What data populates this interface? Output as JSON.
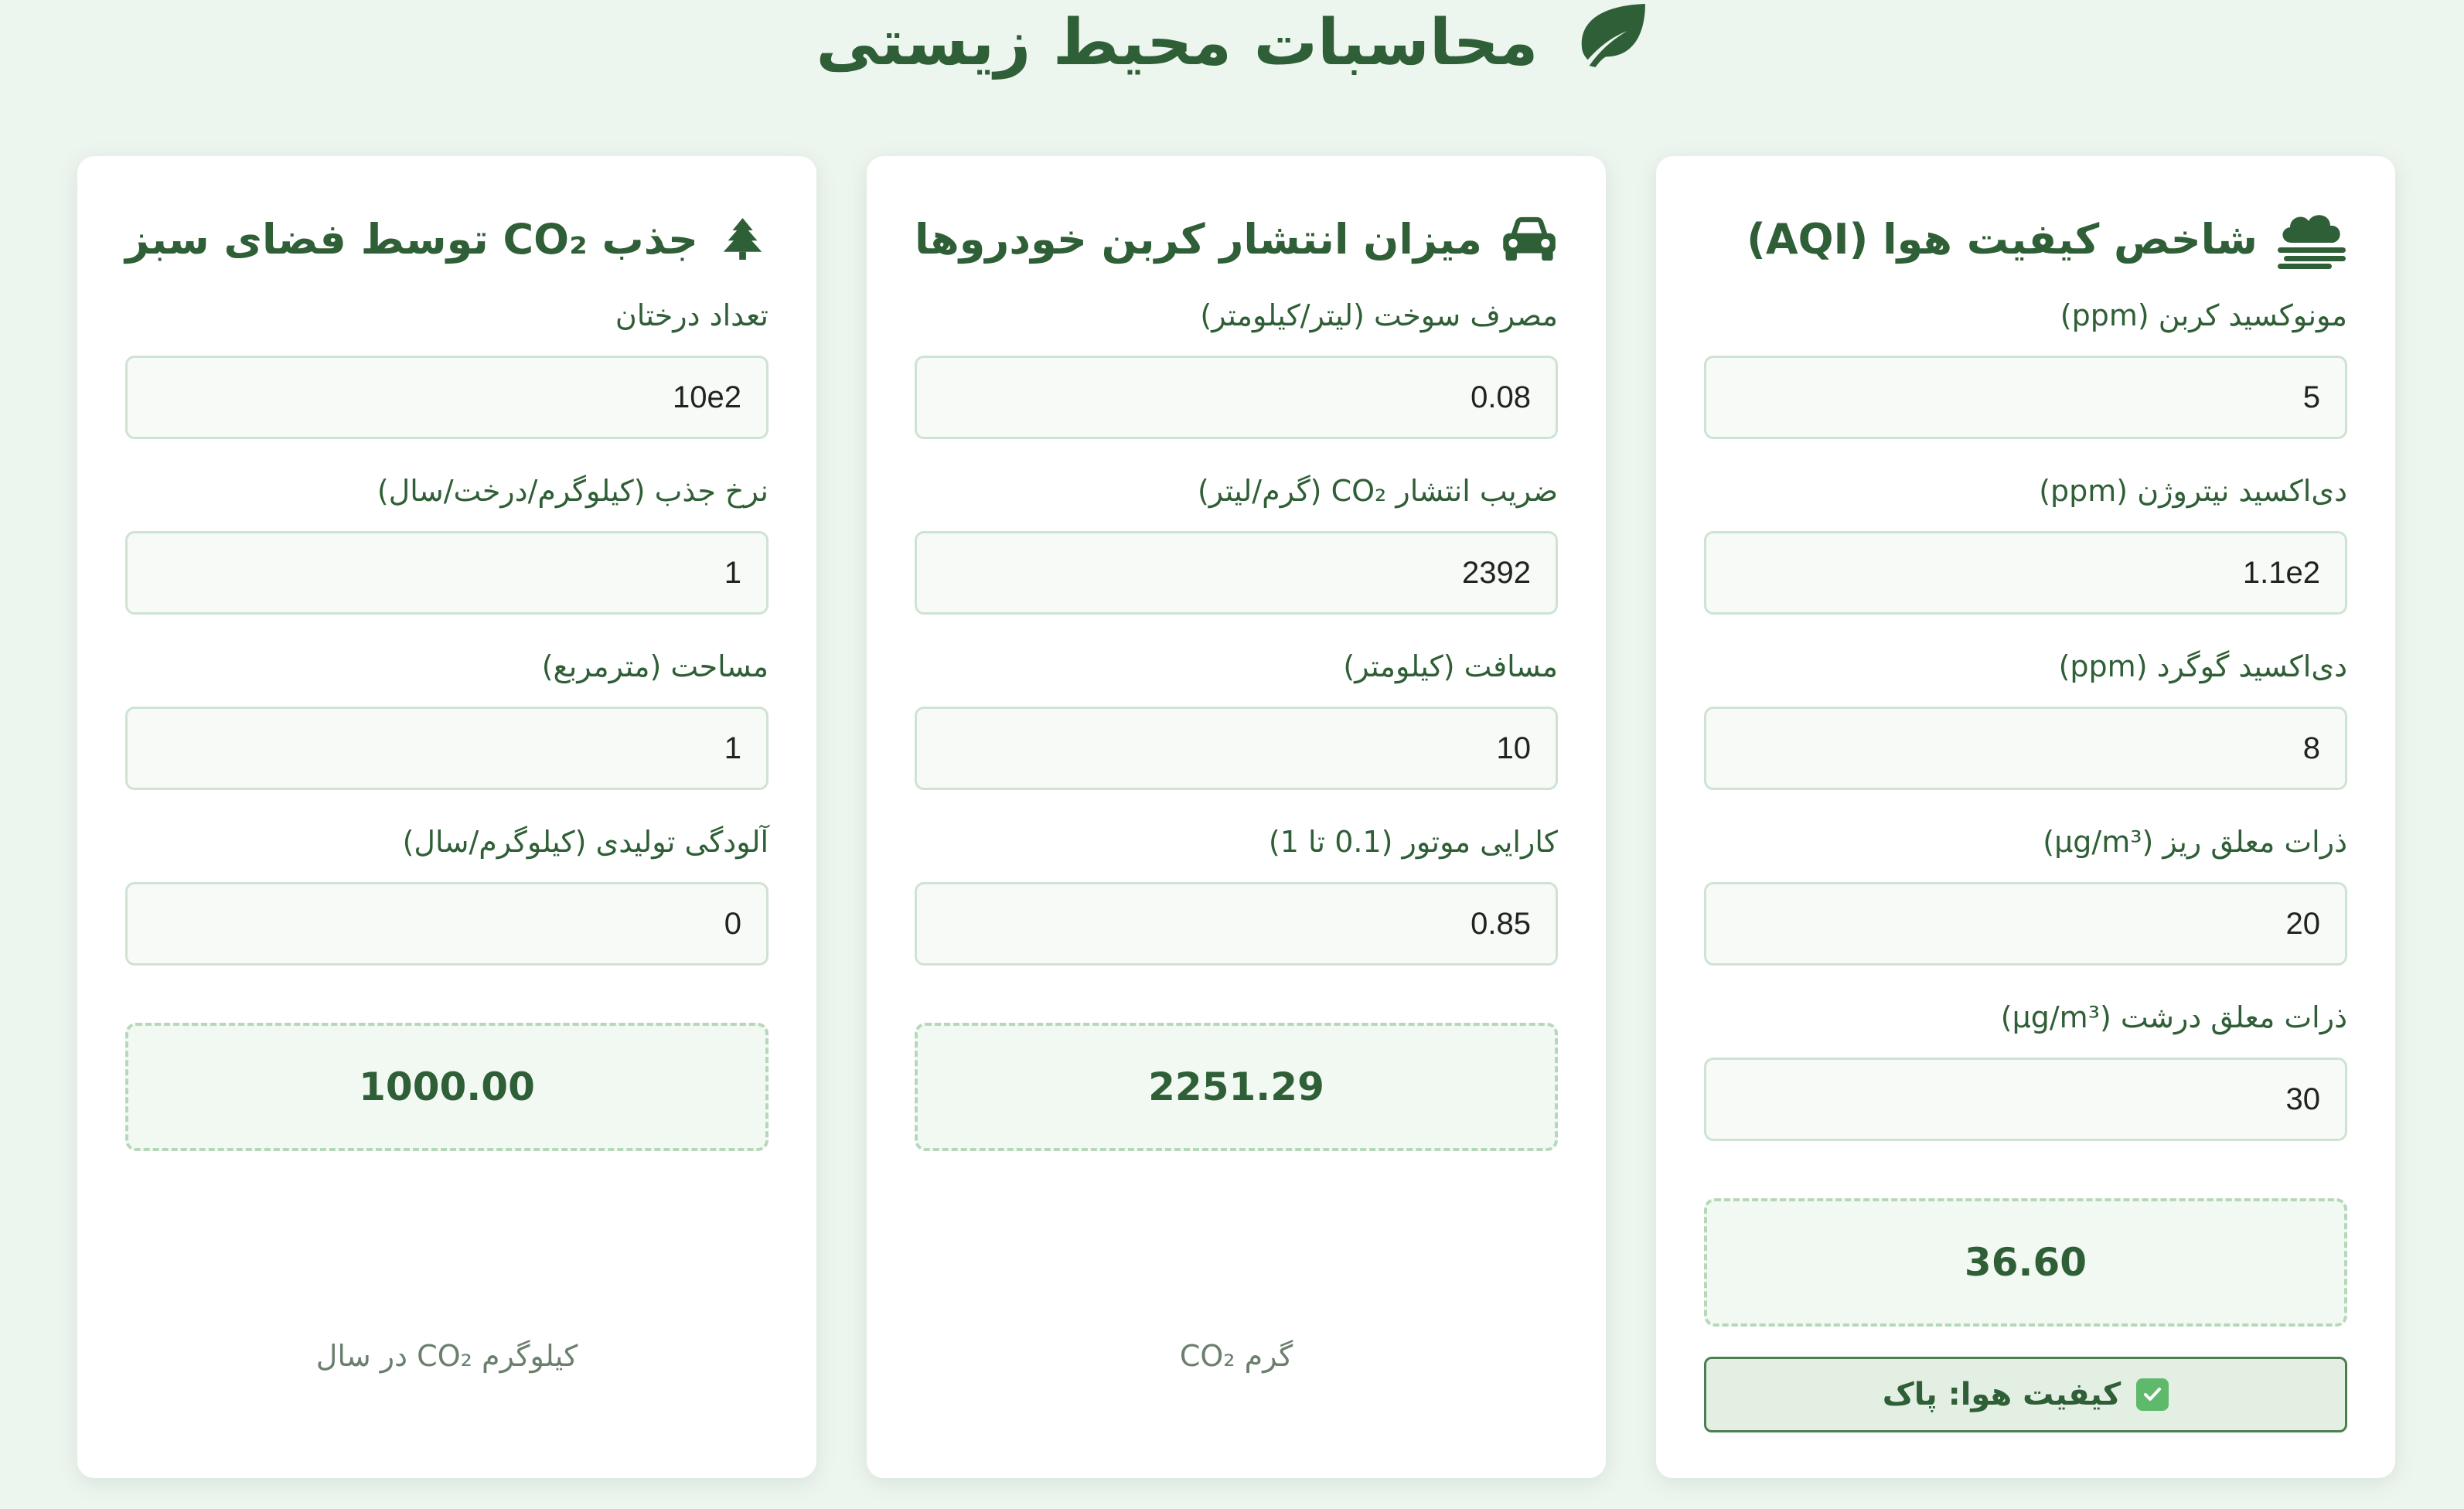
{
  "title": "محاسبات محیط زیستی",
  "cards": {
    "aqi": {
      "title": "شاخص کیفیت هوا (AQI)",
      "icon": "smog-icon",
      "fields": [
        {
          "label": "مونوکسید کربن (ppm)",
          "value": "5"
        },
        {
          "label": "دی‌اکسید نیتروژن (ppm)",
          "value": "1.1e2"
        },
        {
          "label": "دی‌اکسید گوگرد (ppm)",
          "value": "8"
        },
        {
          "label": "ذرات معلق ریز (µg/m³)",
          "value": "20"
        },
        {
          "label": "ذرات معلق درشت (µg/m³)",
          "value": "30"
        }
      ],
      "result": "36.60",
      "status": "کیفیت هوا: پاک",
      "status_icon": "check-square-icon"
    },
    "car": {
      "title": "میزان انتشار کربن خودروها",
      "icon": "car-icon",
      "fields": [
        {
          "label": "مصرف سوخت (لیتر/کیلومتر)",
          "value": "0.08"
        },
        {
          "label": "ضریب انتشار CO₂ (گرم/لیتر)",
          "value": "2392"
        },
        {
          "label": "مسافت (کیلومتر)",
          "value": "10"
        },
        {
          "label": "کارایی موتور (0.1 تا 1)",
          "value": "0.85"
        }
      ],
      "result": "2251.29",
      "unit": "گرم CO₂"
    },
    "tree": {
      "title": "جذب CO₂ توسط فضای سبز",
      "icon": "tree-icon",
      "fields": [
        {
          "label": "تعداد درختان",
          "value": "10e2"
        },
        {
          "label": "نرخ جذب (کیلوگرم/درخت/سال)",
          "value": "1"
        },
        {
          "label": "مساحت (مترمربع)",
          "value": "1"
        },
        {
          "label": "آلودگی تولیدی (کیلوگرم/سال)",
          "value": "0"
        }
      ],
      "result": "1000.00",
      "unit": "کیلوگرم CO₂ در سال"
    }
  },
  "colors": {
    "accent": "#2f5f36",
    "background": "#edf5ef",
    "input_border": "#cfe3d2",
    "result_border": "#b6d8ba",
    "check": "#5fb96b"
  }
}
